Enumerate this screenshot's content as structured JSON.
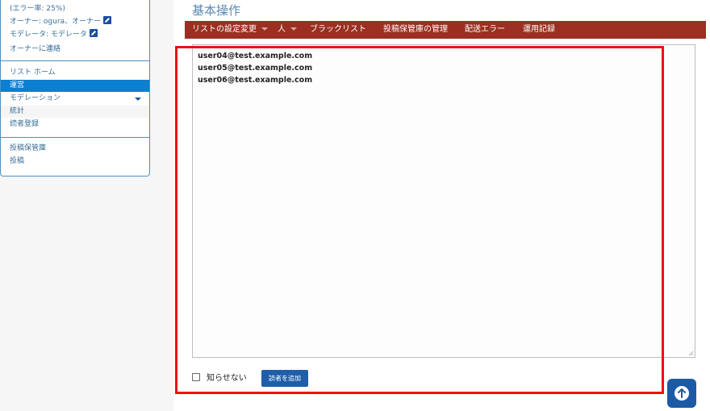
{
  "sidebar": {
    "error_rate": "(エラー率: 25%)",
    "owner": "オーナー: ogura、オーナー",
    "moderator": "モデレータ: モデレータ",
    "contact_owner": "オーナーに連絡",
    "list_home": "リスト ホーム",
    "items": [
      {
        "label": "運営",
        "active": true
      },
      {
        "label": "モデレーション"
      },
      {
        "label": "統計"
      },
      {
        "label": "読者登録"
      }
    ],
    "archive_items": [
      {
        "label": "投稿保管庫"
      },
      {
        "label": "投稿"
      }
    ]
  },
  "page_title": "基本操作",
  "menubar": {
    "items": [
      {
        "label": "リストの設定変更"
      },
      {
        "label": "人"
      },
      {
        "label": "ブラックリスト"
      },
      {
        "label": "投稿保管庫の管理"
      },
      {
        "label": "配送エラー"
      },
      {
        "label": "運用記録"
      }
    ]
  },
  "textarea": {
    "lines": [
      "user04@test.example.com",
      "user05@test.example.com",
      "user06@test.example.com"
    ]
  },
  "form": {
    "checkbox_label": "知らせない",
    "checkbox_checked": false,
    "add_button": "読者を追加"
  },
  "colors": {
    "menubar_bg": "#9c2f21",
    "active_item_bg": "#0b7fd1",
    "button_bg": "#1d5fa8",
    "highlight_border": "#ee1111"
  }
}
